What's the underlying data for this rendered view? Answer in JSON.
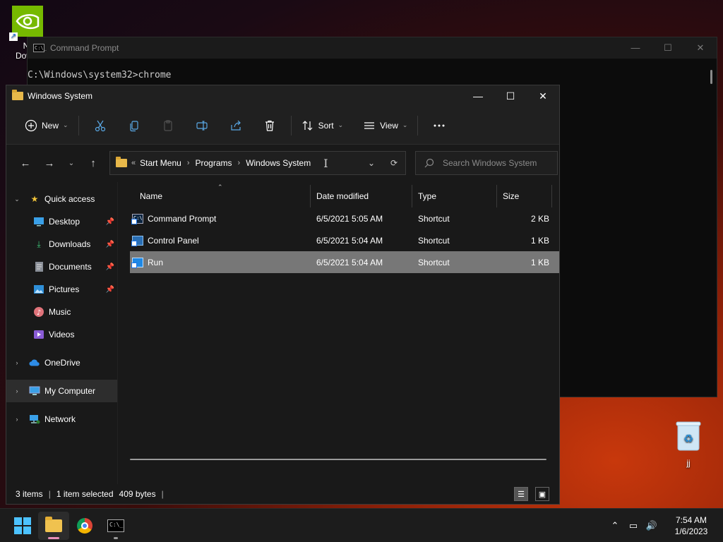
{
  "desktop": {
    "nvidia_label_line1": "Nvi",
    "nvidia_label_line2": "Dowr",
    "recycle_label": "jj"
  },
  "cmd": {
    "title": "Command Prompt",
    "line1": "C:\\Windows\\system32>chrome",
    "icon_text": "C:\\_"
  },
  "explorer": {
    "title": "Windows System",
    "toolbar": {
      "new_label": "New",
      "sort_label": "Sort",
      "view_label": "View"
    },
    "address": {
      "overflow": "«",
      "crumbs": [
        "Start Menu",
        "Programs",
        "Windows System"
      ]
    },
    "search": {
      "placeholder": "Search Windows System"
    },
    "sidebar": {
      "quick_access": "Quick access",
      "items": [
        "Desktop",
        "Downloads",
        "Documents",
        "Pictures",
        "Music",
        "Videos"
      ],
      "onedrive": "OneDrive",
      "my_computer": "My Computer",
      "network": "Network"
    },
    "columns": {
      "name": "Name",
      "date": "Date modified",
      "type": "Type",
      "size": "Size"
    },
    "files": [
      {
        "name": "Command Prompt",
        "date": "6/5/2021 5:05 AM",
        "type": "Shortcut",
        "size": "2 KB"
      },
      {
        "name": "Control Panel",
        "date": "6/5/2021 5:04 AM",
        "type": "Shortcut",
        "size": "1 KB"
      },
      {
        "name": "Run",
        "date": "6/5/2021 5:04 AM",
        "type": "Shortcut",
        "size": "1 KB"
      }
    ],
    "status": {
      "items": "3 items",
      "selected": "1 item selected",
      "bytes": "409 bytes"
    }
  },
  "taskbar": {
    "time": "7:54 AM",
    "date": "1/6/2023"
  },
  "colors": {
    "accent": "#4cc2ff",
    "selection": "#777777",
    "nvidia": "#76b900"
  }
}
